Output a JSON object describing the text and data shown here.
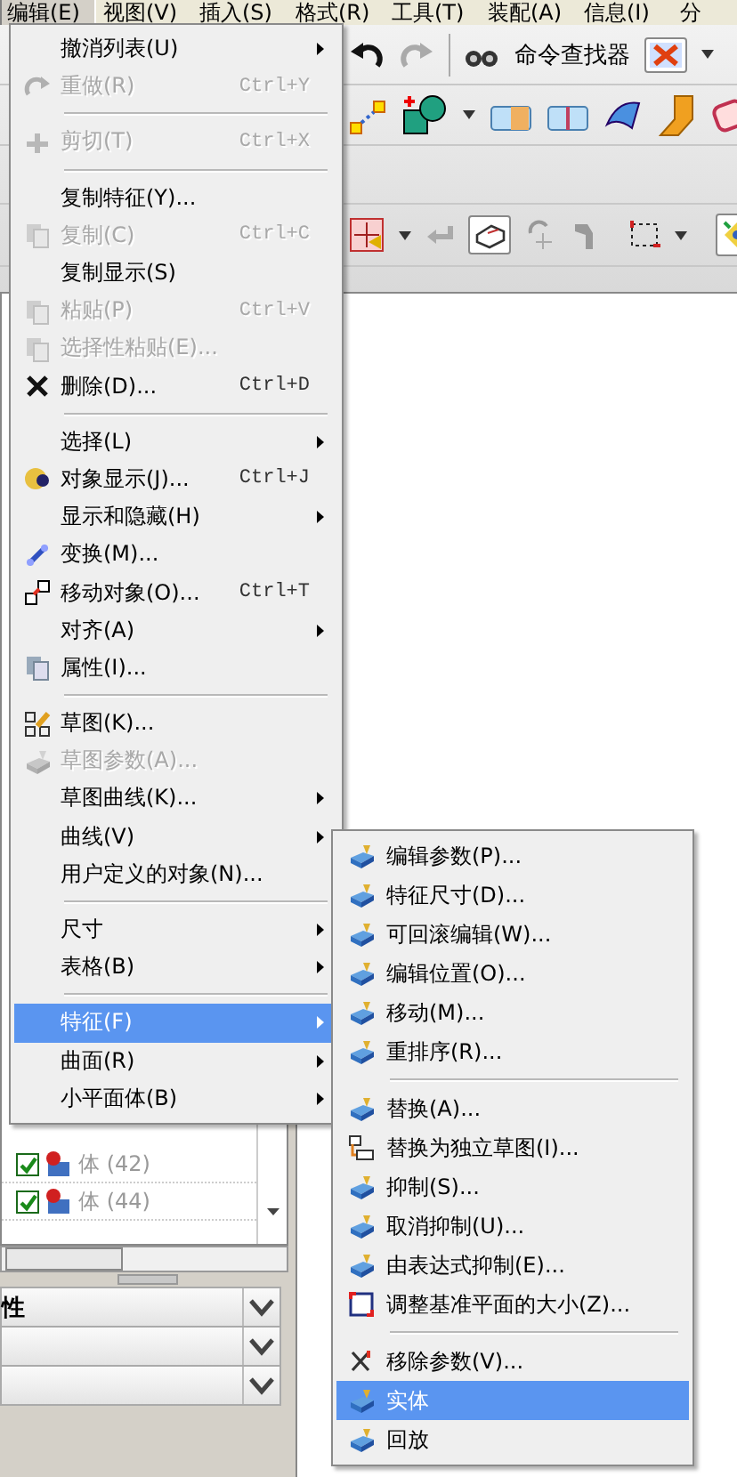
{
  "menu_bar": [
    {
      "label": "编辑(E)",
      "selected": true
    },
    {
      "label": "视图(V)",
      "selected": false
    },
    {
      "label": "插入(S)",
      "selected": false
    },
    {
      "label": "格式(R)",
      "selected": false
    },
    {
      "label": "工具(T)",
      "selected": false
    },
    {
      "label": "装配(A)",
      "selected": false
    },
    {
      "label": "信息(I)",
      "selected": false
    },
    {
      "label": "分",
      "selected": false
    }
  ],
  "toolbar": {
    "command_finder": "命令查找器"
  },
  "navigator": {
    "rows": [
      {
        "label": "体 (42)",
        "checked": true
      },
      {
        "label": "体 (44)",
        "checked": true
      }
    ]
  },
  "property_sections": [
    {
      "label": "性",
      "expanded": false
    },
    {
      "expanded": false
    },
    {
      "expanded": false
    }
  ],
  "edit_menu": {
    "items": [
      {
        "kind": "item",
        "label": "撤消列表(U)",
        "submenu": true,
        "disabled": false,
        "selected": false,
        "icon": false
      },
      {
        "kind": "item",
        "label": "重做(R)",
        "shortcut": "Ctrl+Y",
        "submenu": false,
        "disabled": true,
        "selected": false,
        "icon": true
      },
      {
        "kind": "separator"
      },
      {
        "kind": "item",
        "label": "剪切(T)",
        "shortcut": "Ctrl+X",
        "submenu": false,
        "disabled": true,
        "selected": false,
        "icon": true
      },
      {
        "kind": "separator"
      },
      {
        "kind": "item",
        "label": "复制特征(Y)...",
        "submenu": false,
        "disabled": false,
        "selected": false,
        "icon": false
      },
      {
        "kind": "item",
        "label": "复制(C)",
        "shortcut": "Ctrl+C",
        "submenu": false,
        "disabled": true,
        "selected": false,
        "icon": true
      },
      {
        "kind": "item",
        "label": "复制显示(S)",
        "submenu": false,
        "disabled": false,
        "selected": false,
        "icon": false
      },
      {
        "kind": "item",
        "label": "粘贴(P)",
        "shortcut": "Ctrl+V",
        "submenu": false,
        "disabled": true,
        "selected": false,
        "icon": true
      },
      {
        "kind": "item",
        "label": "选择性粘贴(E)...",
        "submenu": false,
        "disabled": true,
        "selected": false,
        "icon": true
      },
      {
        "kind": "item",
        "label": "删除(D)...",
        "shortcut": "Ctrl+D",
        "submenu": false,
        "disabled": false,
        "selected": false,
        "icon": true
      },
      {
        "kind": "separator"
      },
      {
        "kind": "item",
        "label": "选择(L)",
        "submenu": true,
        "disabled": false,
        "selected": false,
        "icon": false
      },
      {
        "kind": "item",
        "label": "对象显示(J)...",
        "shortcut": "Ctrl+J",
        "submenu": false,
        "disabled": false,
        "selected": false,
        "icon": true
      },
      {
        "kind": "item",
        "label": "显示和隐藏(H)",
        "submenu": true,
        "disabled": false,
        "selected": false,
        "icon": false
      },
      {
        "kind": "item",
        "label": "变换(M)...",
        "submenu": false,
        "disabled": false,
        "selected": false,
        "icon": true
      },
      {
        "kind": "item",
        "label": "移动对象(O)...",
        "shortcut": "Ctrl+T",
        "submenu": false,
        "disabled": false,
        "selected": false,
        "icon": true
      },
      {
        "kind": "item",
        "label": "对齐(A)",
        "submenu": true,
        "disabled": false,
        "selected": false,
        "icon": false
      },
      {
        "kind": "item",
        "label": "属性(I)...",
        "submenu": false,
        "disabled": false,
        "selected": false,
        "icon": true
      },
      {
        "kind": "separator"
      },
      {
        "kind": "item",
        "label": "草图(K)...",
        "submenu": false,
        "disabled": false,
        "selected": false,
        "icon": true
      },
      {
        "kind": "item",
        "label": "草图参数(A)...",
        "submenu": false,
        "disabled": true,
        "selected": false,
        "icon": true
      },
      {
        "kind": "item",
        "label": "草图曲线(K)...",
        "submenu": true,
        "disabled": false,
        "selected": false,
        "icon": false
      },
      {
        "kind": "item",
        "label": "曲线(V)",
        "submenu": true,
        "disabled": false,
        "selected": false,
        "icon": false
      },
      {
        "kind": "item",
        "label": "用户定义的对象(N)...",
        "submenu": false,
        "disabled": false,
        "selected": false,
        "icon": false
      },
      {
        "kind": "separator"
      },
      {
        "kind": "item",
        "label": "尺寸",
        "submenu": true,
        "disabled": false,
        "selected": false,
        "icon": false
      },
      {
        "kind": "item",
        "label": "表格(B)",
        "submenu": true,
        "disabled": false,
        "selected": false,
        "icon": false
      },
      {
        "kind": "separator"
      },
      {
        "kind": "item",
        "label": "特征(F)",
        "submenu": true,
        "disabled": false,
        "selected": true,
        "icon": false
      },
      {
        "kind": "item",
        "label": "曲面(R)",
        "submenu": true,
        "disabled": false,
        "selected": false,
        "icon": false
      },
      {
        "kind": "item",
        "label": "小平面体(B)",
        "submenu": true,
        "disabled": false,
        "selected": false,
        "icon": false
      }
    ]
  },
  "feature_submenu": {
    "items": [
      {
        "kind": "item",
        "label": "编辑参数(P)...",
        "disabled": false,
        "selected": false,
        "icon": true
      },
      {
        "kind": "item",
        "label": "特征尺寸(D)...",
        "disabled": false,
        "selected": false,
        "icon": true
      },
      {
        "kind": "item",
        "label": "可回滚编辑(W)...",
        "disabled": false,
        "selected": false,
        "icon": true
      },
      {
        "kind": "item",
        "label": "编辑位置(O)...",
        "disabled": false,
        "selected": false,
        "icon": true
      },
      {
        "kind": "item",
        "label": "移动(M)...",
        "disabled": false,
        "selected": false,
        "icon": true
      },
      {
        "kind": "item",
        "label": "重排序(R)...",
        "disabled": false,
        "selected": false,
        "icon": true
      },
      {
        "kind": "separator"
      },
      {
        "kind": "item",
        "label": "替换(A)...",
        "disabled": false,
        "selected": false,
        "icon": true
      },
      {
        "kind": "item",
        "label": "替换为独立草图(I)...",
        "disabled": false,
        "selected": false,
        "icon": true
      },
      {
        "kind": "item",
        "label": "抑制(S)...",
        "disabled": false,
        "selected": false,
        "icon": true
      },
      {
        "kind": "item",
        "label": "取消抑制(U)...",
        "disabled": false,
        "selected": false,
        "icon": true
      },
      {
        "kind": "item",
        "label": "由表达式抑制(E)...",
        "disabled": false,
        "selected": false,
        "icon": true
      },
      {
        "kind": "item",
        "label": "调整基准平面的大小(Z)...",
        "disabled": false,
        "selected": false,
        "icon": true
      },
      {
        "kind": "separator"
      },
      {
        "kind": "item",
        "label": "移除参数(V)...",
        "disabled": false,
        "selected": false,
        "icon": true
      },
      {
        "kind": "item",
        "label": "实体",
        "disabled": false,
        "selected": true,
        "icon": true
      },
      {
        "kind": "item",
        "label": "回放",
        "disabled": false,
        "selected": false,
        "icon": true
      }
    ]
  }
}
